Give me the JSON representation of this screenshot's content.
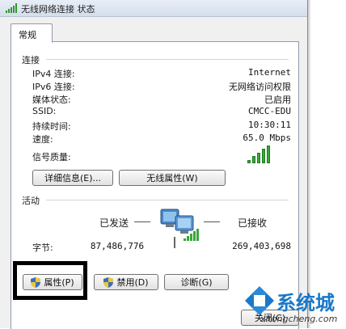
{
  "window": {
    "title": "无线网络连接 状态",
    "tab": "常规"
  },
  "connection": {
    "group_title": "连接",
    "rows": [
      {
        "label": "IPv4 连接:",
        "value": "Internet"
      },
      {
        "label": "IPv6 连接:",
        "value": "无网络访问权限"
      },
      {
        "label": "媒体状态:",
        "value": "已启用"
      },
      {
        "label": "SSID:",
        "value": "CMCC-EDU"
      },
      {
        "label": "持续时间:",
        "value": "10:30:11"
      },
      {
        "label": "速度:",
        "value": "65.0 Mbps"
      }
    ],
    "signal_label": "信号质量:",
    "signal_level": 5,
    "signal_max": 5,
    "details_button": "详细信息(E)...",
    "wireless_props_button": "无线属性(W)"
  },
  "activity": {
    "group_title": "活动",
    "sent_label": "已发送",
    "received_label": "已接收",
    "bytes_label": "字节:",
    "bytes_sent": "87,486,776",
    "bytes_received": "269,403,698"
  },
  "buttons": {
    "properties": "属性(P)",
    "disable": "禁用(D)",
    "diagnose": "诊断(G)",
    "close": "关闭(C)"
  },
  "watermark": {
    "brand": "系统城",
    "url": "xitongcheng.com"
  },
  "colors": {
    "signal_green": "#3aa63a",
    "window_bg": "#f0f0f0",
    "panel_border": "#8e9bb0",
    "watermark_blue": "#1a78c8"
  }
}
